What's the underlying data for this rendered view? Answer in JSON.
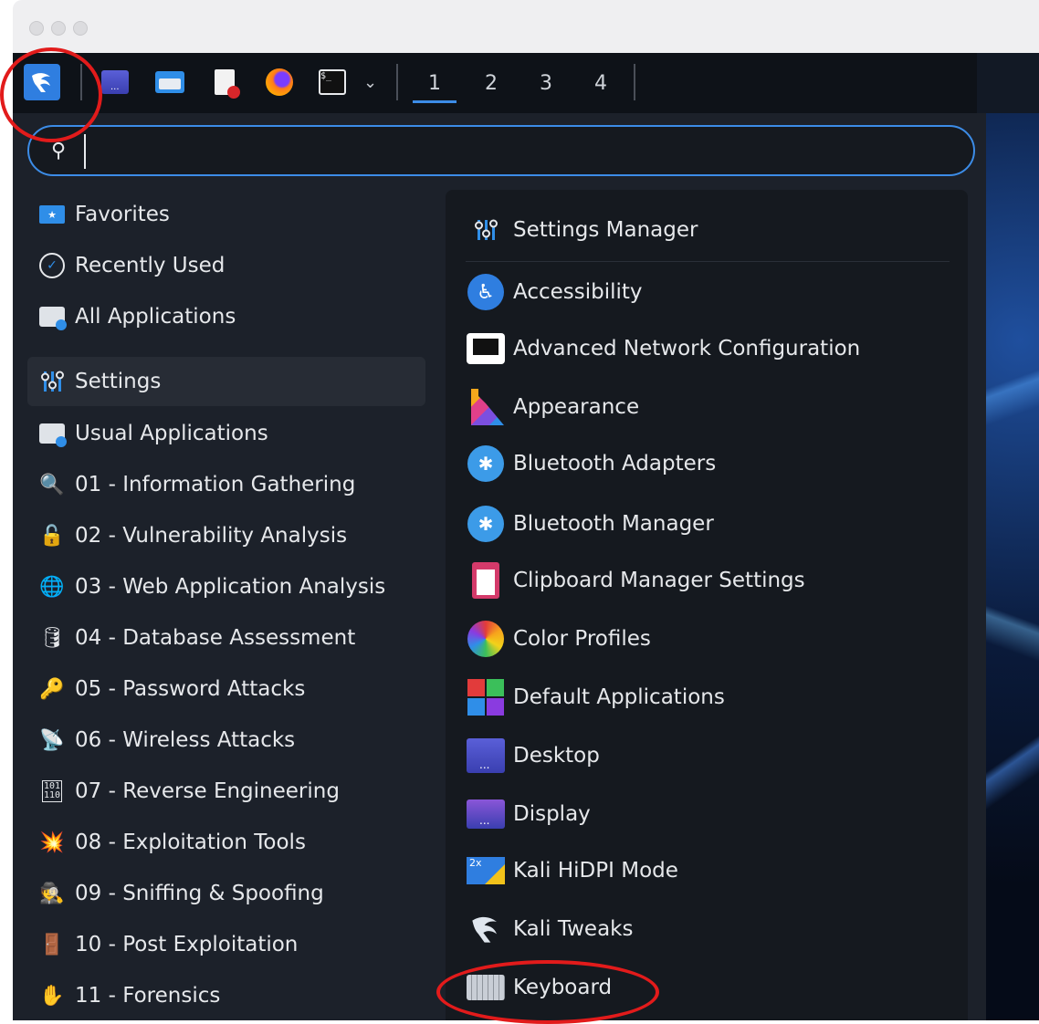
{
  "panel": {
    "workspaces": [
      "1",
      "2",
      "3",
      "4"
    ],
    "active_workspace": "1",
    "launchers": [
      "kali-menu-icon",
      "terminal-icon",
      "file-manager-icon",
      "text-editor-icon",
      "firefox-icon",
      "terminal-emulator-icon"
    ]
  },
  "search": {
    "value": "",
    "placeholder": ""
  },
  "categories": [
    {
      "label": "Favorites",
      "icon": "folder-star-icon"
    },
    {
      "label": "Recently Used",
      "icon": "clock-icon"
    },
    {
      "label": "All Applications",
      "icon": "briefcase-icon"
    },
    {
      "label": "Settings",
      "icon": "sliders-icon",
      "selected": true
    },
    {
      "label": "Usual Applications",
      "icon": "briefcase-icon"
    },
    {
      "label": "01 - Information Gathering",
      "icon": "magnifier-icon"
    },
    {
      "label": "02 - Vulnerability Analysis",
      "icon": "lock-icon"
    },
    {
      "label": "03 - Web Application Analysis",
      "icon": "globe-icon"
    },
    {
      "label": "04 - Database Assessment",
      "icon": "database-icon"
    },
    {
      "label": "05 - Password Attacks",
      "icon": "key-icon"
    },
    {
      "label": "06 - Wireless Attacks",
      "icon": "wireless-icon"
    },
    {
      "label": "07 - Reverse Engineering",
      "icon": "binary-icon"
    },
    {
      "label": "08 - Exploitation Tools",
      "icon": "explosion-icon"
    },
    {
      "label": "09 - Sniffing & Spoofing",
      "icon": "spy-icon"
    },
    {
      "label": "10 - Post Exploitation",
      "icon": "exit-icon"
    },
    {
      "label": "11 - Forensics",
      "icon": "hand-icon"
    }
  ],
  "apps": [
    {
      "label": "Settings Manager",
      "icon": "settings-manager-icon"
    },
    {
      "label": "Accessibility",
      "icon": "accessibility-icon"
    },
    {
      "label": "Advanced Network Configuration",
      "icon": "network-icon"
    },
    {
      "label": "Appearance",
      "icon": "appearance-icon"
    },
    {
      "label": "Bluetooth Adapters",
      "icon": "bluetooth-icon"
    },
    {
      "label": "Bluetooth Manager",
      "icon": "bluetooth-icon"
    },
    {
      "label": "Clipboard Manager Settings",
      "icon": "clipboard-icon"
    },
    {
      "label": "Color Profiles",
      "icon": "color-profiles-icon"
    },
    {
      "label": "Default Applications",
      "icon": "default-apps-icon"
    },
    {
      "label": "Desktop",
      "icon": "desktop-icon"
    },
    {
      "label": "Display",
      "icon": "display-icon"
    },
    {
      "label": "Kali HiDPI Mode",
      "icon": "hidpi-icon"
    },
    {
      "label": "Kali Tweaks",
      "icon": "kali-dragon-icon"
    },
    {
      "label": "Keyboard",
      "icon": "keyboard-icon"
    }
  ],
  "colors": {
    "accent": "#3c8ce7",
    "annotation": "#e21b1b",
    "menu_bg": "#1c212a",
    "panel_bg": "#0e1218"
  }
}
